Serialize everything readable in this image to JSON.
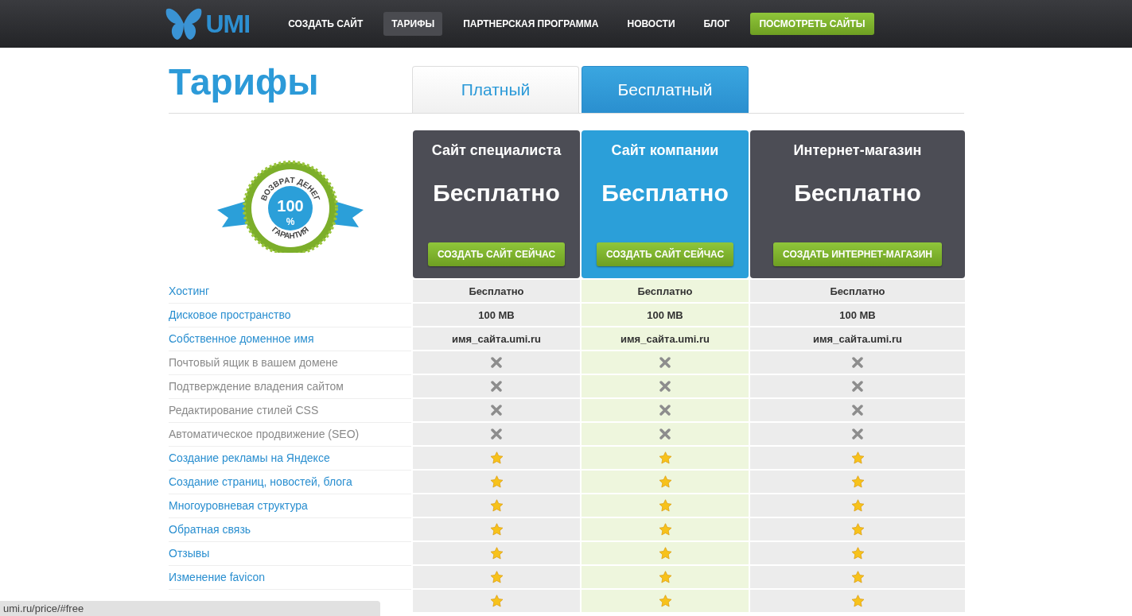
{
  "nav": {
    "logo": "UMI",
    "items": [
      {
        "label": "СОЗДАТЬ САЙТ",
        "selected": false
      },
      {
        "label": "ТАРИФЫ",
        "selected": true
      },
      {
        "label": "ПАРТНЕРСКАЯ ПРОГРАММА",
        "selected": false
      },
      {
        "label": "НОВОСТИ",
        "selected": false
      },
      {
        "label": "БЛОГ",
        "selected": false
      }
    ],
    "cta": "ПОСМОТРЕТЬ САЙТЫ"
  },
  "title": "Тарифы",
  "tabs": [
    {
      "label": "Платный",
      "selected": false
    },
    {
      "label": "Бесплатный",
      "selected": true
    }
  ],
  "badge": {
    "top": "ВОЗВРАТ ДЕНЕГ",
    "number": "100",
    "unit": "%",
    "bottom": "ГАРАНТИЯ"
  },
  "plans": [
    {
      "name": "Сайт специалиста",
      "price": "Бесплатно",
      "button": "СОЗДАТЬ САЙТ СЕЙЧАС",
      "selected": false
    },
    {
      "name": "Сайт компании",
      "price": "Бесплатно",
      "button": "СОЗДАТЬ САЙТ СЕЙЧАС",
      "selected": true
    },
    {
      "name": "Интернет-магазин",
      "price": "Бесплатно",
      "button": "СОЗДАТЬ ИНТЕРНЕТ-МАГАЗИН",
      "selected": false
    }
  ],
  "features": [
    {
      "label": "Хостинг",
      "kind": "link",
      "cells": [
        {
          "kind": "text",
          "text": "Бесплатно"
        },
        {
          "kind": "text",
          "text": "Бесплатно"
        },
        {
          "kind": "text",
          "text": "Бесплатно"
        }
      ]
    },
    {
      "label": "Дисковое пространство",
      "kind": "link",
      "cells": [
        {
          "kind": "text",
          "text": "100 MB"
        },
        {
          "kind": "text",
          "text": "100 MB"
        },
        {
          "kind": "text",
          "text": "100 MB"
        }
      ]
    },
    {
      "label": "Собственное доменное имя",
      "kind": "link",
      "cells": [
        {
          "kind": "text",
          "text": "имя_сайта.umi.ru"
        },
        {
          "kind": "text",
          "text": "имя_сайта.umi.ru"
        },
        {
          "kind": "text",
          "text": "имя_сайта.umi.ru"
        }
      ]
    },
    {
      "label": "Почтовый ящик в вашем домене",
      "kind": "muted",
      "cells": [
        {
          "kind": "cross"
        },
        {
          "kind": "cross"
        },
        {
          "kind": "cross"
        }
      ]
    },
    {
      "label": "Подтверждение владения сайтом",
      "kind": "muted",
      "cells": [
        {
          "kind": "cross"
        },
        {
          "kind": "cross"
        },
        {
          "kind": "cross"
        }
      ]
    },
    {
      "label": "Редактирование стилей CSS",
      "kind": "muted",
      "cells": [
        {
          "kind": "cross"
        },
        {
          "kind": "cross"
        },
        {
          "kind": "cross"
        }
      ]
    },
    {
      "label": "Автоматическое продвижение (SEO)",
      "kind": "muted",
      "cells": [
        {
          "kind": "cross"
        },
        {
          "kind": "cross"
        },
        {
          "kind": "cross"
        }
      ]
    },
    {
      "label": "Создание рекламы на Яндексе",
      "kind": "link",
      "cells": [
        {
          "kind": "star"
        },
        {
          "kind": "star"
        },
        {
          "kind": "star"
        }
      ]
    },
    {
      "label": "Создание страниц, новостей, блога",
      "kind": "link",
      "cells": [
        {
          "kind": "star"
        },
        {
          "kind": "star"
        },
        {
          "kind": "star"
        }
      ]
    },
    {
      "label": "Многоуровневая структура",
      "kind": "link",
      "cells": [
        {
          "kind": "star"
        },
        {
          "kind": "star"
        },
        {
          "kind": "star"
        }
      ]
    },
    {
      "label": "Обратная связь",
      "kind": "link",
      "cells": [
        {
          "kind": "star"
        },
        {
          "kind": "star"
        },
        {
          "kind": "star"
        }
      ]
    },
    {
      "label": "Отзывы",
      "kind": "link",
      "cells": [
        {
          "kind": "star"
        },
        {
          "kind": "star"
        },
        {
          "kind": "star"
        }
      ]
    },
    {
      "label": "Изменение favicon",
      "kind": "link",
      "cells": [
        {
          "kind": "star"
        },
        {
          "kind": "star"
        },
        {
          "kind": "star"
        }
      ]
    },
    {
      "cells": [
        {
          "kind": "star"
        },
        {
          "kind": "star"
        },
        {
          "kind": "star"
        }
      ]
    }
  ],
  "status_bar": "umi.ru/price/#free"
}
